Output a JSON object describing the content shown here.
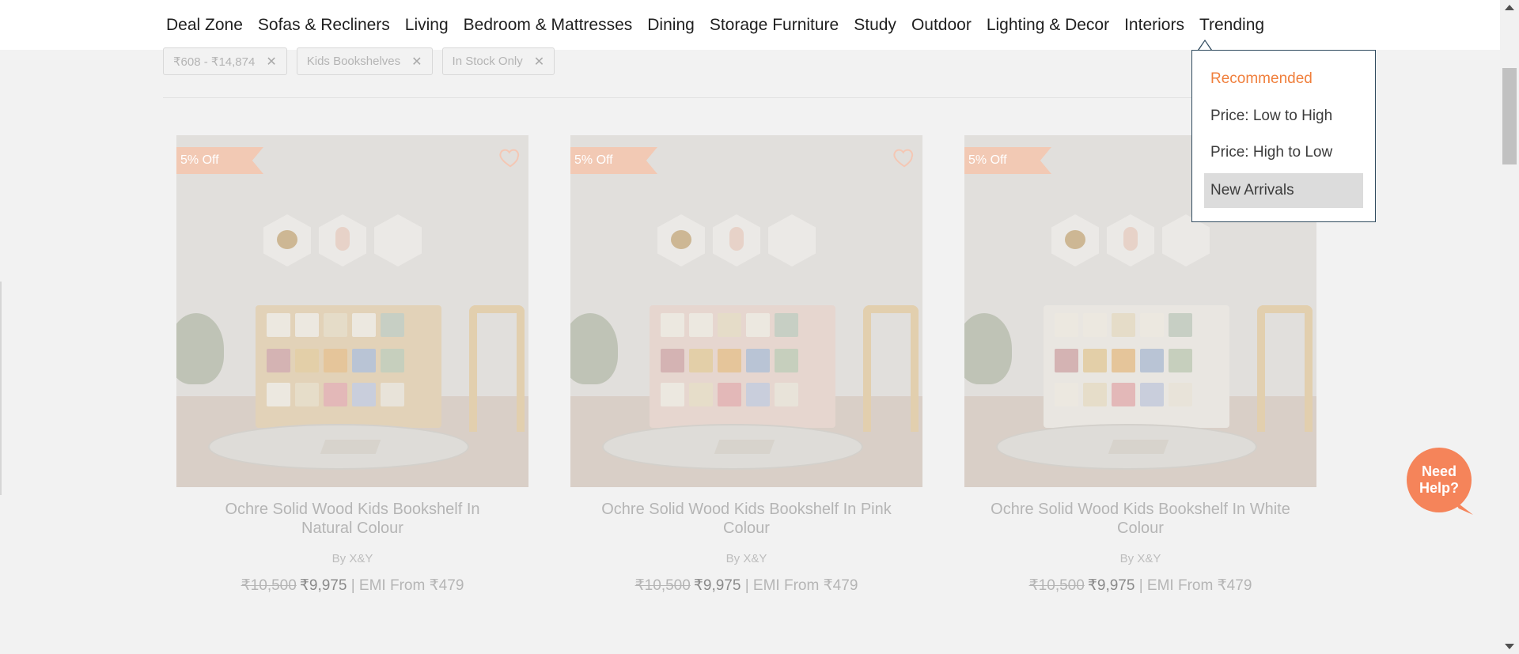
{
  "nav": {
    "items": [
      "Deal Zone",
      "Sofas & Recliners",
      "Living",
      "Bedroom & Mattresses",
      "Dining",
      "Storage Furniture",
      "Study",
      "Outdoor",
      "Lighting & Decor",
      "Interiors",
      "Trending"
    ]
  },
  "filters": {
    "chips": [
      {
        "label": "₹608 - ₹14,874",
        "remove": "✕"
      },
      {
        "label": "Kids Bookshelves",
        "remove": "✕"
      },
      {
        "label": "In Stock Only",
        "remove": "✕"
      }
    ]
  },
  "products": [
    {
      "badge": "5% Off",
      "title": "Ochre Solid Wood Kids Bookshelf In Natural Colour",
      "brand": "By X&Y",
      "mrp": "₹10,500",
      "price": "₹9,975",
      "emi": "| EMI From ₹479"
    },
    {
      "badge": "5% Off",
      "title": "Ochre Solid Wood Kids Bookshelf In Pink Colour",
      "brand": "By X&Y",
      "mrp": "₹10,500",
      "price": "₹9,975",
      "emi": "| EMI From ₹479"
    },
    {
      "badge": "5% Off",
      "title": "Ochre Solid Wood Kids Bookshelf In White Colour",
      "brand": "By X&Y",
      "mrp": "₹10,500",
      "price": "₹9,975",
      "emi": "| EMI From ₹479"
    }
  ],
  "sort": {
    "options": [
      "Recommended",
      "Price: Low to High",
      "Price: High to Low",
      "New Arrivals"
    ],
    "selected": "Recommended",
    "hovered": "New Arrivals"
  },
  "help": {
    "label_line1": "Need",
    "label_line2": "Help?"
  },
  "colors": {
    "accent": "#f07f3c",
    "help_bubble": "#f5845a",
    "dropdown_border": "#2f4a5e"
  },
  "icons": {
    "wishlist": "heart-icon",
    "remove_filter": "close-icon"
  }
}
